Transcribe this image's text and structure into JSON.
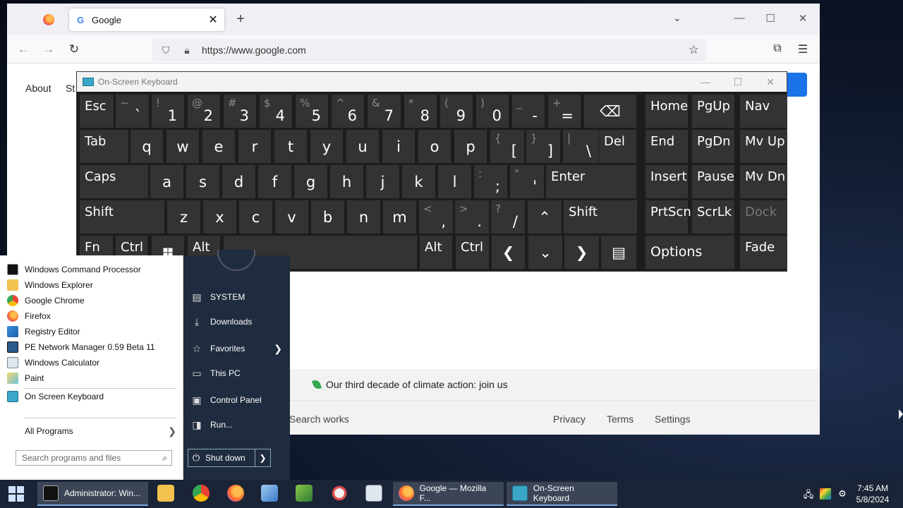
{
  "browser": {
    "tab_title": "Google",
    "url": "https://www.google.com",
    "tab_favicon": "G"
  },
  "google": {
    "nav_links": [
      "About",
      "St"
    ],
    "climate_text": "Our third decade of climate action: join us",
    "footer_links": [
      "Search works",
      "Privacy",
      "Terms",
      "Settings"
    ]
  },
  "osk": {
    "title": "On-Screen Keyboard",
    "rows": [
      [
        {
          "label": "Esc"
        },
        {
          "upper": "~",
          "lower": "`"
        },
        {
          "upper": "!",
          "lower": "1"
        },
        {
          "upper": "@",
          "lower": "2"
        },
        {
          "upper": "#",
          "lower": "3"
        },
        {
          "upper": "$",
          "lower": "4"
        },
        {
          "upper": "%",
          "lower": "5"
        },
        {
          "upper": "^",
          "lower": "6"
        },
        {
          "upper": "&",
          "lower": "7"
        },
        {
          "upper": "*",
          "lower": "8"
        },
        {
          "upper": "(",
          "lower": "9"
        },
        {
          "upper": ")",
          "lower": "0"
        },
        {
          "upper": "_",
          "lower": "-"
        },
        {
          "upper": "+",
          "lower": "="
        },
        {
          "center": "⌫"
        },
        {
          "label": "Home"
        },
        {
          "label": "PgUp"
        },
        {
          "label": "Nav"
        }
      ],
      [
        {
          "label": "Tab"
        },
        {
          "center": "q"
        },
        {
          "center": "w"
        },
        {
          "center": "e"
        },
        {
          "center": "r"
        },
        {
          "center": "t"
        },
        {
          "center": "y"
        },
        {
          "center": "u"
        },
        {
          "center": "i"
        },
        {
          "center": "o"
        },
        {
          "center": "p"
        },
        {
          "upper": "{",
          "lower": "["
        },
        {
          "upper": "}",
          "lower": "]"
        },
        {
          "upper": "|",
          "lower": "\\"
        },
        {
          "label": "Del"
        },
        {
          "label": "End"
        },
        {
          "label": "PgDn"
        },
        {
          "label": "Mv Up"
        }
      ],
      [
        {
          "label": "Caps"
        },
        {
          "center": "a"
        },
        {
          "center": "s"
        },
        {
          "center": "d"
        },
        {
          "center": "f"
        },
        {
          "center": "g"
        },
        {
          "center": "h"
        },
        {
          "center": "j"
        },
        {
          "center": "k"
        },
        {
          "center": "l"
        },
        {
          "upper": ":",
          "lower": ";"
        },
        {
          "upper": "\"",
          "lower": "'"
        },
        {
          "label": "Enter"
        },
        {
          "label": "Insert"
        },
        {
          "label": "Pause"
        },
        {
          "label": "Mv Dn"
        }
      ],
      [
        {
          "label": "Shift"
        },
        {
          "center": "z"
        },
        {
          "center": "x"
        },
        {
          "center": "c"
        },
        {
          "center": "v"
        },
        {
          "center": "b"
        },
        {
          "center": "n"
        },
        {
          "center": "m"
        },
        {
          "upper": "<",
          "lower": ","
        },
        {
          "upper": ">",
          "lower": "."
        },
        {
          "upper": "?",
          "lower": "/"
        },
        {
          "center": "⌃"
        },
        {
          "label": "Shift"
        },
        {
          "label": "PrtScn"
        },
        {
          "label": "ScrLk"
        },
        {
          "label": "Dock"
        }
      ],
      [
        {
          "label": "Fn"
        },
        {
          "label": "Ctrl"
        },
        {
          "center": "win"
        },
        {
          "label": "Alt"
        },
        {
          "label": ""
        },
        {
          "label": "Alt"
        },
        {
          "label": "Ctrl"
        },
        {
          "center": "❮"
        },
        {
          "center": "⌄"
        },
        {
          "center": "❯"
        },
        {
          "center": "▤"
        },
        {
          "label": "Options"
        },
        {
          "label": "Fade"
        }
      ]
    ]
  },
  "start_menu": {
    "programs": [
      "Windows Command Processor",
      "Windows Explorer",
      "Google Chrome",
      "Firefox",
      "Registry Editor",
      "PE Network Manager 0.59 Beta 11",
      "Windows Calculator",
      "Paint",
      "On Screen Keyboard"
    ],
    "all_programs": "All Programs",
    "search_placeholder": "Search programs and files",
    "right_items": [
      "SYSTEM",
      "Downloads",
      "Favorites",
      "This PC",
      "Control Panel",
      "Run..."
    ],
    "shutdown": "Shut down"
  },
  "taskbar": {
    "windows": [
      "Administrator: Win...",
      "Google — Mozilla F...",
      "On-Screen Keyboard"
    ],
    "time": "7:45 AM",
    "date": "5/8/2024"
  }
}
